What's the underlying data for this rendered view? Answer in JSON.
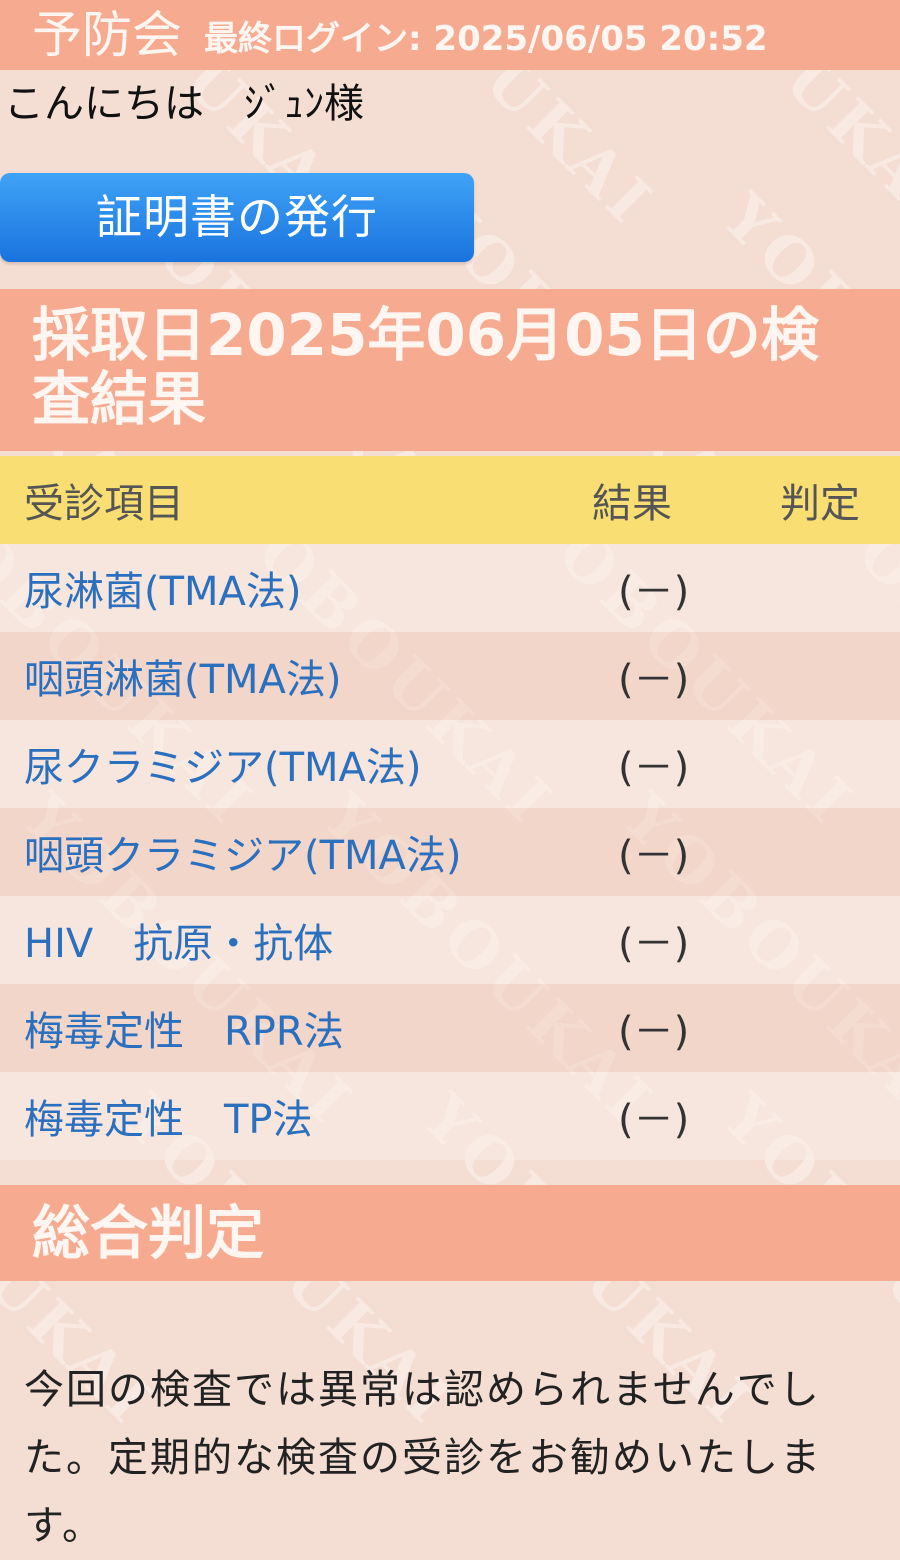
{
  "header": {
    "app_title": "予防会",
    "last_login": "最終ログイン: 2025/06/05 20:52"
  },
  "greeting": "こんにちは　ｼﾞｭﾝ様",
  "certificate_button": "証明書の発行",
  "result_title": "採取日2025年06月05日の検査結果",
  "table": {
    "headers": {
      "item": "受診項目",
      "result": "結果",
      "judgement": "判定"
    },
    "rows": [
      {
        "item": "尿淋菌(TMA法)",
        "result": "(－)",
        "judgement": ""
      },
      {
        "item": "咽頭淋菌(TMA法)",
        "result": "(－)",
        "judgement": ""
      },
      {
        "item": "尿クラミジア(TMA法)",
        "result": "(－)",
        "judgement": ""
      },
      {
        "item": "咽頭クラミジア(TMA法)",
        "result": "(－)",
        "judgement": ""
      },
      {
        "item": "HIV　抗原・抗体",
        "result": "(－)",
        "judgement": ""
      },
      {
        "item": "梅毒定性　RPR法",
        "result": "(－)",
        "judgement": ""
      },
      {
        "item": "梅毒定性　TP法",
        "result": "(－)",
        "judgement": ""
      }
    ]
  },
  "summary": {
    "title": "総合判定",
    "text": "今回の検査では異常は認められませんでした。定期的な検査の受診をお勧めいたします。"
  },
  "watermark": "YOBOUKAI",
  "colors": {
    "header_bg": "#f6ab91",
    "table_head_bg": "#f9df73",
    "button_blue": "#1a73de",
    "item_text": "#2b6fbf",
    "page_bg": "#f4ddd2"
  }
}
